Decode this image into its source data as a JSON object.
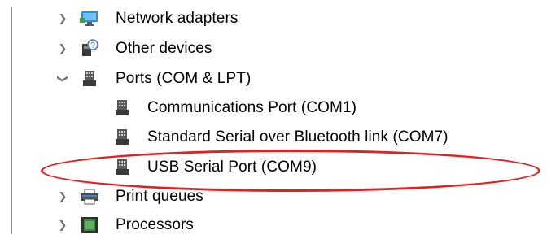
{
  "tree": {
    "items": [
      {
        "label": "Network adapters",
        "expanded": false,
        "icon": "network-adapter-icon",
        "children": []
      },
      {
        "label": "Other devices",
        "expanded": false,
        "icon": "unknown-device-icon",
        "children": []
      },
      {
        "label": "Ports (COM & LPT)",
        "expanded": true,
        "icon": "port-connector-icon",
        "children": [
          {
            "label": "Communications Port (COM1)",
            "icon": "port-connector-icon"
          },
          {
            "label": "Standard Serial over Bluetooth link (COM7)",
            "icon": "port-connector-icon"
          },
          {
            "label": "USB Serial Port (COM9)",
            "icon": "port-connector-icon",
            "highlighted": true
          }
        ]
      },
      {
        "label": "Print queues",
        "expanded": false,
        "icon": "printer-icon",
        "children": []
      },
      {
        "label": "Processors",
        "expanded": false,
        "icon": "processor-chip-icon",
        "children": []
      }
    ]
  },
  "colors": {
    "highlight_ellipse": "#e32020",
    "chevron": "#6f6f6f",
    "tree_line": "#8a8a8a"
  }
}
